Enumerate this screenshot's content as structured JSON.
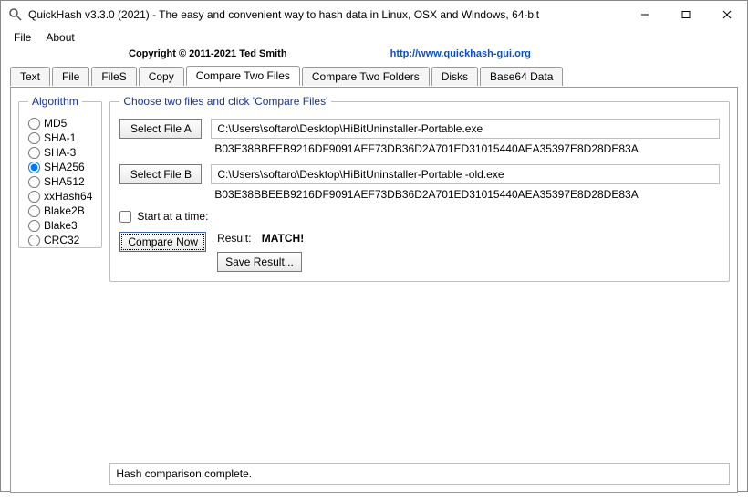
{
  "window": {
    "title": "QuickHash v3.3.0 (2021) - The easy and convenient way to hash data in Linux, OSX and Windows, 64-bit"
  },
  "menu": {
    "file": "File",
    "about": "About"
  },
  "header": {
    "copyright": "Copyright © 2011-2021  Ted Smith",
    "link_text": "http://www.quickhash-gui.org"
  },
  "tabs": {
    "text": "Text",
    "file": "File",
    "files": "FileS",
    "copy": "Copy",
    "compare_two_files": "Compare Two Files",
    "compare_two_folders": "Compare Two Folders",
    "disks": "Disks",
    "base64": "Base64 Data"
  },
  "algo": {
    "legend": "Algorithm",
    "items": [
      "MD5",
      "SHA-1",
      "SHA-3",
      "SHA256",
      "SHA512",
      "xxHash64",
      "Blake2B",
      "Blake3",
      "CRC32"
    ],
    "selected": "SHA256"
  },
  "compare": {
    "legend": "Choose two files and click 'Compare Files'",
    "select_a": "Select File A",
    "path_a": "C:\\Users\\softaro\\Desktop\\HiBitUninstaller-Portable.exe",
    "hash_a": "B03E38BBEEB9216DF9091AEF73DB36D2A701ED31015440AEA35397E8D28DE83A",
    "select_b": "Select File B",
    "path_b": "C:\\Users\\softaro\\Desktop\\HiBitUninstaller-Portable -old.exe",
    "hash_b": "B03E38BBEEB9216DF9091AEF73DB36D2A701ED31015440AEA35397E8D28DE83A",
    "start_at": "Start at a time:",
    "compare_now": "Compare Now",
    "result_label": "Result:",
    "result_value": "MATCH!",
    "save_result": "Save Result...",
    "status": "Hash comparison complete."
  }
}
